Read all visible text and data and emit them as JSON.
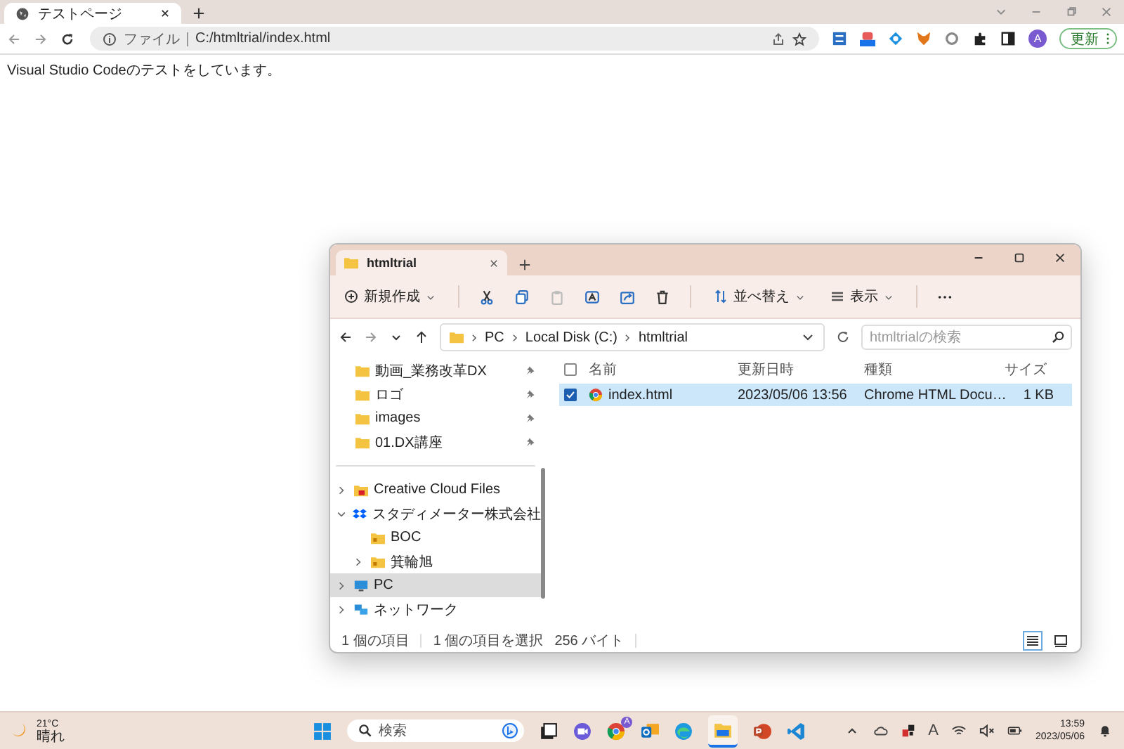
{
  "browser": {
    "tab": {
      "title": "テストページ",
      "selected": true
    },
    "address": {
      "scheme": "ファイル",
      "url": "C:/htmltrial/index.html"
    },
    "profile": "A",
    "update_button": "更新",
    "page_text": "Visual Studio Codeのテストをしています。"
  },
  "explorer": {
    "tab": {
      "title": "htmltrial",
      "selected": true
    },
    "toolbar": {
      "new": "新規作成",
      "sort": "並べ替え",
      "view": "表示"
    },
    "breadcrumb": [
      "PC",
      "Local Disk (C:)",
      "htmltrial"
    ],
    "search": {
      "placeholder": "htmltrialの検索"
    },
    "quick_access": [
      {
        "label": "動画_業務改革DX",
        "pinned": true
      },
      {
        "label": "ロゴ",
        "pinned": true
      },
      {
        "label": "images",
        "pinned": true
      },
      {
        "label": "01.DX講座",
        "pinned": true
      }
    ],
    "nav": [
      {
        "label": "Creative Cloud Files",
        "kind": "cloud",
        "expanded": false,
        "selected": false
      },
      {
        "label": "スタディメーター株式会社",
        "kind": "dropbox",
        "expanded": true,
        "selected": false,
        "children": [
          {
            "label": "BOC",
            "kind": "folder",
            "selected": false
          },
          {
            "label": "箕輪旭",
            "kind": "folder",
            "expanded": false,
            "selected": false
          }
        ]
      },
      {
        "label": "PC",
        "kind": "pc",
        "expanded": false,
        "selected": true
      },
      {
        "label": "ネットワーク",
        "kind": "network",
        "expanded": false,
        "selected": false
      }
    ],
    "select_all": {
      "checked": false
    },
    "columns": [
      "名前",
      "更新日時",
      "種類",
      "サイズ"
    ],
    "rows": [
      {
        "name": "index.html",
        "date": "2023/05/06 13:56",
        "type": "Chrome HTML Docu…",
        "size": "1 KB",
        "selected": true
      }
    ],
    "status": {
      "count": "1 個の項目",
      "selection": "1 個の項目を選択",
      "size": "256 バイト"
    }
  },
  "taskbar": {
    "temperature": "21°C",
    "condition": "晴れ",
    "search_placeholder": "検索",
    "chrome_badge": "A",
    "ime": "A",
    "time": "13:59",
    "date": "2023/05/06"
  }
}
